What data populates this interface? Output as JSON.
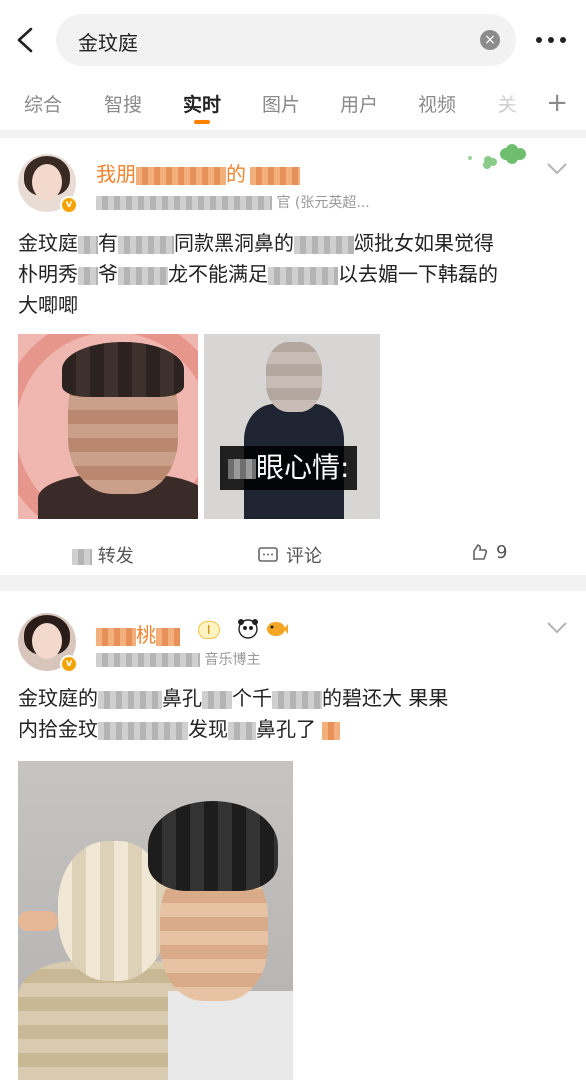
{
  "search": {
    "query": "金玟庭",
    "clear_icon": "×"
  },
  "tabs": [
    {
      "label": "综合"
    },
    {
      "label": "智搜"
    },
    {
      "label": "实时"
    },
    {
      "label": "图片"
    },
    {
      "label": "用户"
    },
    {
      "label": "视频"
    },
    {
      "label": "关"
    }
  ],
  "tab_add": "+",
  "accent_color": "#ff8200",
  "posts": [
    {
      "nickname_start": "我朋",
      "nickname_end": "的",
      "meta_visible": "官 (张元英超...",
      "text_line1_a": "金玟庭",
      "text_line1_b": "有",
      "text_line1_c": "同款黑洞鼻的",
      "text_line1_d": "颂批女如果觉得",
      "text_line2_a": "朴明秀",
      "text_line2_b": "爷",
      "text_line2_c": "龙不能满足",
      "text_line2_d": "以去媚一下韩磊的",
      "text_line3": "大唧唧",
      "image2_caption": "眼心情:",
      "actions": {
        "repost": "转发",
        "comment": "评论",
        "like_count": "9"
      }
    },
    {
      "nickname_visible": "桃",
      "level": "I",
      "meta_visible": "音乐博主",
      "text_line1_a": "金玟庭的",
      "text_line1_b": "鼻孔",
      "text_line1_c": "个千",
      "text_line1_d": "的碧还大 果果",
      "text_line2_a": "内拾金玟",
      "text_line2_b": "发现",
      "text_line2_c": "鼻孔了"
    }
  ]
}
